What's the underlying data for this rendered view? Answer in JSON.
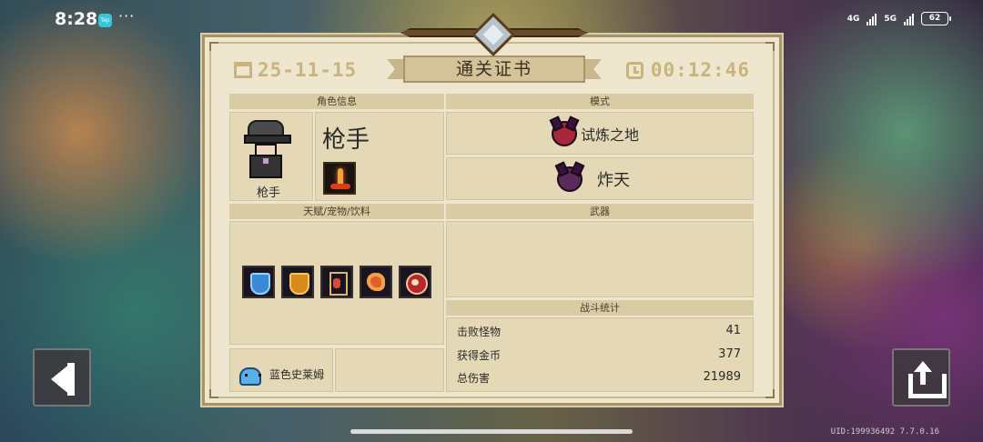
{
  "status_bar": {
    "time": "8:28",
    "app_badge": "Tap",
    "more": "···",
    "network1": "4G",
    "network2": "5G",
    "battery": "62"
  },
  "certificate": {
    "date": "25-11-15",
    "title": "通关证书",
    "duration": "00:12:46",
    "sections": {
      "character": "角色信息",
      "mode": "模式",
      "talents": "天赋/宠物/饮料",
      "weapon": "武器",
      "battle_stats": "战斗统计"
    },
    "character": {
      "name": "枪手",
      "sprite_label": "枪手"
    },
    "modes": [
      {
        "label": "试炼之地",
        "icon": "trial-demon-icon"
      },
      {
        "label": "炸天",
        "icon": "boom-demon-icon"
      }
    ],
    "buffs": [
      "blue-shield-icon",
      "gold-shield-icon",
      "potion-icon",
      "fire-claw-icon",
      "paw-icon"
    ],
    "pet": {
      "name": "蓝色史莱姆",
      "icon": "blue-slime-icon"
    },
    "stats": [
      {
        "label": "击败怪物",
        "value": "41"
      },
      {
        "label": "获得金币",
        "value": "377"
      },
      {
        "label": "总伤害",
        "value": "21989"
      }
    ]
  },
  "footer": {
    "uid": "UID:199936492 7.7.0.16"
  }
}
